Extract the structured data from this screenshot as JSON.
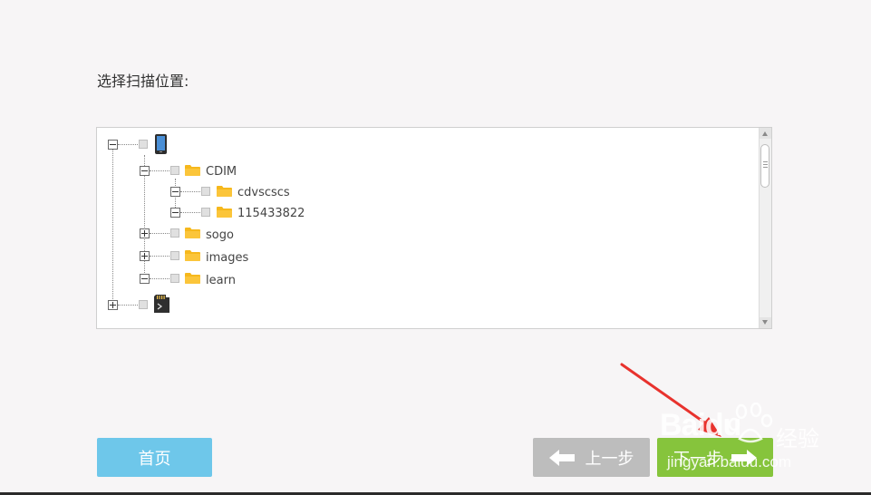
{
  "prompt": "选择扫描位置:",
  "tree": {
    "nodes": [
      {
        "label": "",
        "icon": "phone-icon",
        "expanded": true
      },
      {
        "label": "CDIM",
        "icon": "folder-icon",
        "expanded": true
      },
      {
        "label": "cdvscscs",
        "icon": "folder-icon",
        "expanded": true
      },
      {
        "label": "115433822",
        "icon": "folder-icon",
        "expanded": true
      },
      {
        "label": "sogo",
        "icon": "folder-icon",
        "expanded": false
      },
      {
        "label": "images",
        "icon": "folder-icon",
        "expanded": false
      },
      {
        "label": "learn",
        "icon": "folder-icon",
        "expanded": true
      },
      {
        "label": "",
        "icon": "sd-card-icon",
        "expanded": false
      }
    ]
  },
  "buttons": {
    "home": "首页",
    "prev": "上一步",
    "next": "下一步"
  },
  "watermark": {
    "brand": "Baidu",
    "suffix": "经验",
    "url": "jingyan.baidu.com"
  },
  "colors": {
    "home_button": "#6ec7ea",
    "prev_button": "#bdbdbd",
    "next_button": "#86c43c",
    "folder": "#f6b81c",
    "annotation_arrow": "#e8322d"
  }
}
